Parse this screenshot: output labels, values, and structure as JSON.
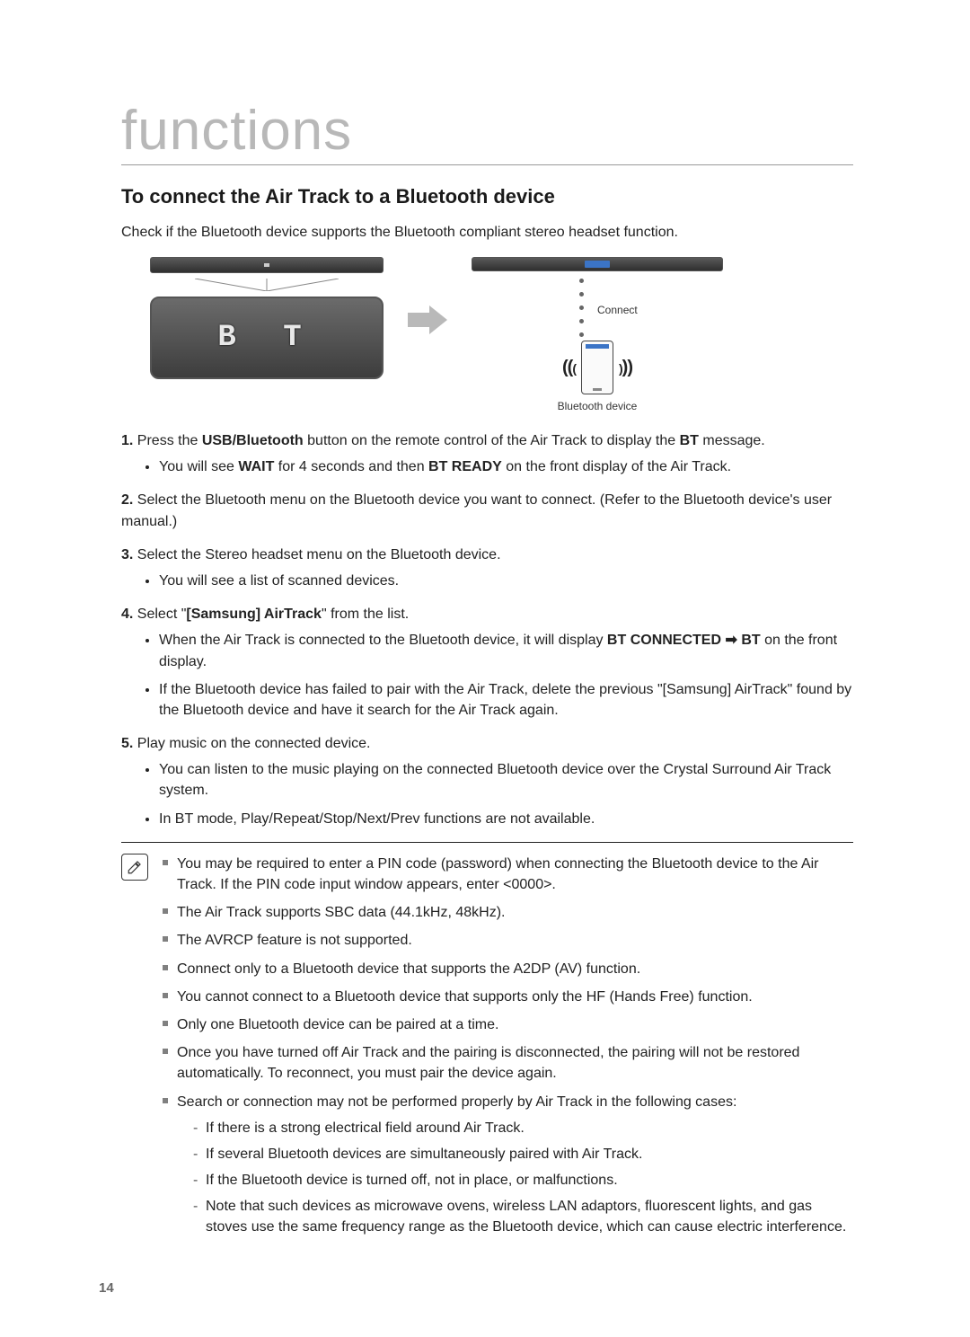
{
  "header": "functions",
  "subhead": "To connect the Air Track to a Bluetooth device",
  "intro": "Check if the Bluetooth device supports the Bluetooth compliant stereo headset function.",
  "fig": {
    "display_text": "B T",
    "connect_label": "Connect",
    "bt_device_caption": "Bluetooth device"
  },
  "steps": {
    "s1_pre": "Press the ",
    "s1_btn": "USB/Bluetooth",
    "s1_mid": " button on the remote control of the Air Track to display the ",
    "s1_bt": "BT",
    "s1_post": " message.",
    "s1_b1_pre": "You will see ",
    "s1_b1_wait": "WAIT",
    "s1_b1_mid": " for 4 seconds and then ",
    "s1_b1_ready": "BT READY",
    "s1_b1_post": " on the front display of the Air Track.",
    "s2": "Select the Bluetooth menu on the Bluetooth device you want to connect. (Refer to the Bluetooth device's user manual.)",
    "s3": "Select the Stereo headset menu on the Bluetooth device.",
    "s3_b1": "You will see a list of scanned devices.",
    "s4_pre": "Select \"",
    "s4_name": "[Samsung] AirTrack",
    "s4_post": "\" from the list.",
    "s4_b1_pre": "When the Air Track is connected to the Bluetooth device, it will display ",
    "s4_b1_conn": "BT CONNECTED",
    "s4_b1_arrow": " ➡ ",
    "s4_b1_bt": "BT",
    "s4_b1_post": " on the front display.",
    "s4_b2": "If the Bluetooth device has failed to pair with the Air Track, delete the previous \"[Samsung] AirTrack\" found by the Bluetooth device and have it search for the Air Track again.",
    "s5": "Play music on the connected device.",
    "s5_b1": "You can listen to the music playing on the connected Bluetooth device over the Crystal Surround Air Track system.",
    "s5_b2": "In BT mode, Play/Repeat/Stop/Next/Prev functions are not available."
  },
  "notes": {
    "n1": "You may be required to enter a PIN code (password) when connecting the Bluetooth device to the Air Track. If the PIN code input window appears, enter <0000>.",
    "n2": "The Air Track supports SBC data (44.1kHz, 48kHz).",
    "n3": "The AVRCP feature is not supported.",
    "n4": "Connect only to a Bluetooth device that supports the A2DP (AV) function.",
    "n5": "You cannot connect to a Bluetooth device that supports only the HF (Hands Free) function.",
    "n6": "Only one Bluetooth device can be paired at a time.",
    "n7": "Once you have turned off Air Track and the pairing is disconnected, the pairing will not be restored automatically. To reconnect, you must pair the device again.",
    "n8": "Search or connection may not be performed properly by Air Track in the following cases:",
    "n8_d1": "If there is a strong electrical field around Air Track.",
    "n8_d2": "If several Bluetooth devices are simultaneously paired with Air Track.",
    "n8_d3": "If the Bluetooth device is turned off, not in place, or malfunctions.",
    "n8_d4": "Note that such devices as microwave ovens, wireless LAN adaptors, fluorescent lights, and gas stoves use the same frequency range as the Bluetooth device, which can cause electric interference."
  },
  "pagenum": "14",
  "nums": {
    "n1": "1",
    "n2": "2",
    "n3": "3",
    "n4": "4",
    "n5": "5"
  }
}
